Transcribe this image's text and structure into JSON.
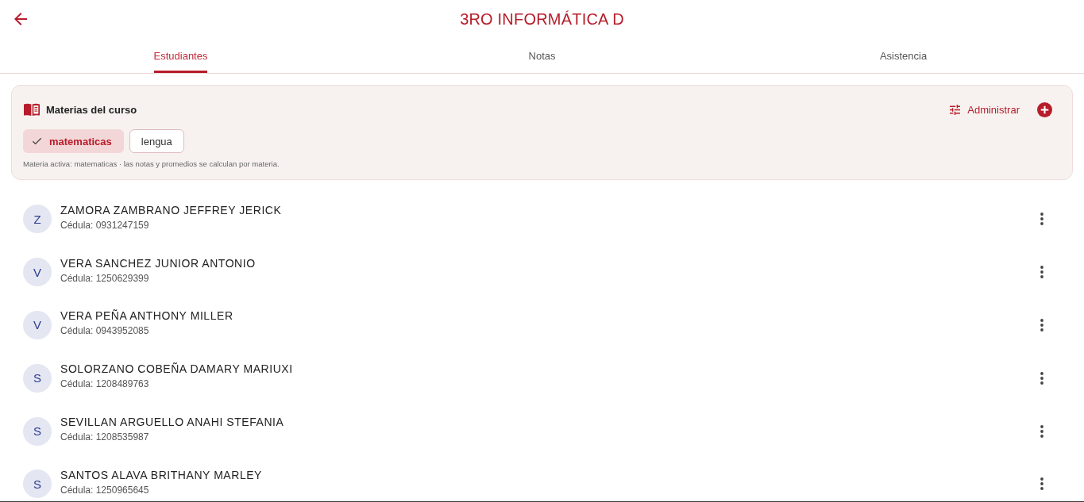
{
  "header": {
    "title": "3RO INFORMÁTICA D"
  },
  "tabs": [
    {
      "label": "Estudiantes",
      "selected": true
    },
    {
      "label": "Notas",
      "selected": false
    },
    {
      "label": "Asistencia",
      "selected": false
    }
  ],
  "subjects": {
    "title": "Materias del curso",
    "manage_label": "Administrar",
    "chips": [
      {
        "label": "matematicas",
        "selected": true
      },
      {
        "label": "lengua",
        "selected": false
      }
    ],
    "note": "Materia activa: matematicas · las notas y promedios se calculan por materia."
  },
  "students": [
    {
      "initial": "Z",
      "name": "ZAMORA ZAMBRANO JEFFREY JERICK",
      "id_text": "Cédula: 0931247159"
    },
    {
      "initial": "V",
      "name": "VERA SANCHEZ JUNIOR ANTONIO",
      "id_text": "Cédula: 1250629399"
    },
    {
      "initial": "V",
      "name": "VERA PEÑA ANTHONY MILLER",
      "id_text": "Cédula: 0943952085"
    },
    {
      "initial": "S",
      "name": "SOLORZANO COBEÑA DAMARY MARIUXI",
      "id_text": "Cédula: 1208489763"
    },
    {
      "initial": "S",
      "name": "SEVILLAN ARGUELLO ANAHI STEFANIA",
      "id_text": "Cédula: 1208535987"
    },
    {
      "initial": "S",
      "name": "SANTOS ALAVA BRITHANY MARLEY",
      "id_text": "Cédula: 1250965645"
    }
  ]
}
